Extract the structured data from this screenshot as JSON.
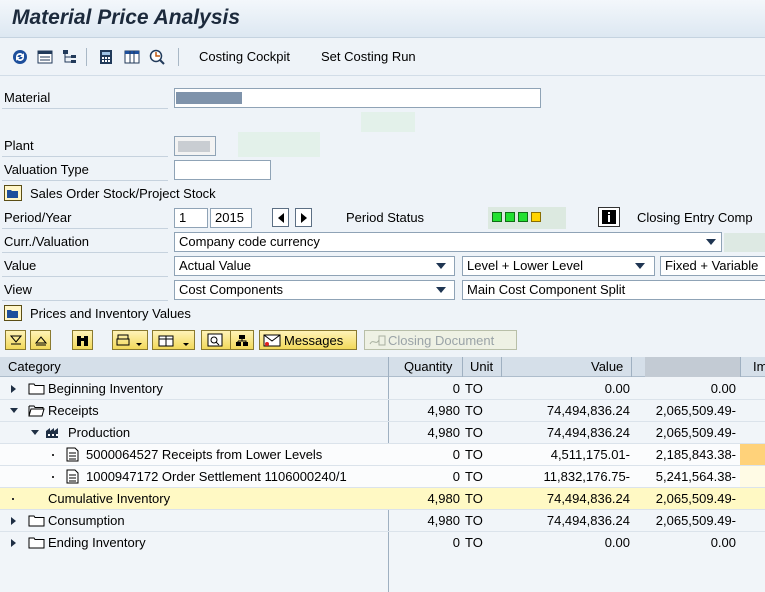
{
  "title": "Material Price Analysis",
  "toolbar": {
    "costing_cockpit": "Costing Cockpit",
    "set_costing_run": "Set Costing Run"
  },
  "form": {
    "material_label": "Material",
    "plant_label": "Plant",
    "valuation_type_label": "Valuation Type",
    "sales_order_stock": "Sales Order Stock/Project Stock",
    "period_year_label": "Period/Year",
    "period_value": "1",
    "year_value": "2015",
    "period_status_label": "Period Status",
    "closing_entry_label": "Closing Entry Comp",
    "curr_valuation_label": "Curr./Valuation",
    "curr_valuation_value": "Company code currency",
    "value_label": "Value",
    "value_value": "Actual Value",
    "level_value": "Level + Lower Level",
    "fixed_variable_value": "Fixed + Variable",
    "view_label": "View",
    "view_value": "Cost Components",
    "cost_component_split_value": "Main Cost Component Split",
    "prices_inventory": "Prices and Inventory Values"
  },
  "table_toolbar": {
    "messages": "Messages",
    "closing_document": "Closing Document"
  },
  "grid": {
    "headers": {
      "category": "Category",
      "quantity": "Quantity",
      "unit": "Unit",
      "value": "Value",
      "extra": "Im"
    },
    "rows": [
      {
        "category": "Beginning Inventory",
        "quantity": "0",
        "unit": "TO",
        "value": "0.00",
        "value2": "0.00"
      },
      {
        "category": "Receipts",
        "quantity": "4,980",
        "unit": "TO",
        "value": "74,494,836.24",
        "value2": "2,065,509.49-"
      },
      {
        "category": "Production",
        "quantity": "4,980",
        "unit": "TO",
        "value": "74,494,836.24",
        "value2": "2,065,509.49-"
      },
      {
        "category": "5000064527 Receipts from Lower Levels",
        "quantity": "0",
        "unit": "TO",
        "value": "4,511,175.01-",
        "value2": "2,185,843.38-"
      },
      {
        "category": "1000947172 Order Settlement 1106000240/1",
        "quantity": "0",
        "unit": "TO",
        "value": "11,832,176.75-",
        "value2": "5,241,564.38-"
      },
      {
        "category": "Cumulative Inventory",
        "quantity": "4,980",
        "unit": "TO",
        "value": "74,494,836.24",
        "value2": "2,065,509.49-"
      },
      {
        "category": "Consumption",
        "quantity": "4,980",
        "unit": "TO",
        "value": "74,494,836.24",
        "value2": "2,065,509.49-"
      },
      {
        "category": "Ending Inventory",
        "quantity": "0",
        "unit": "TO",
        "value": "0.00",
        "value2": "0.00"
      }
    ]
  },
  "colors": {
    "highlight_row": "#fff9c4",
    "led_green": "#22e030",
    "led_yellow": "#ffd400"
  }
}
